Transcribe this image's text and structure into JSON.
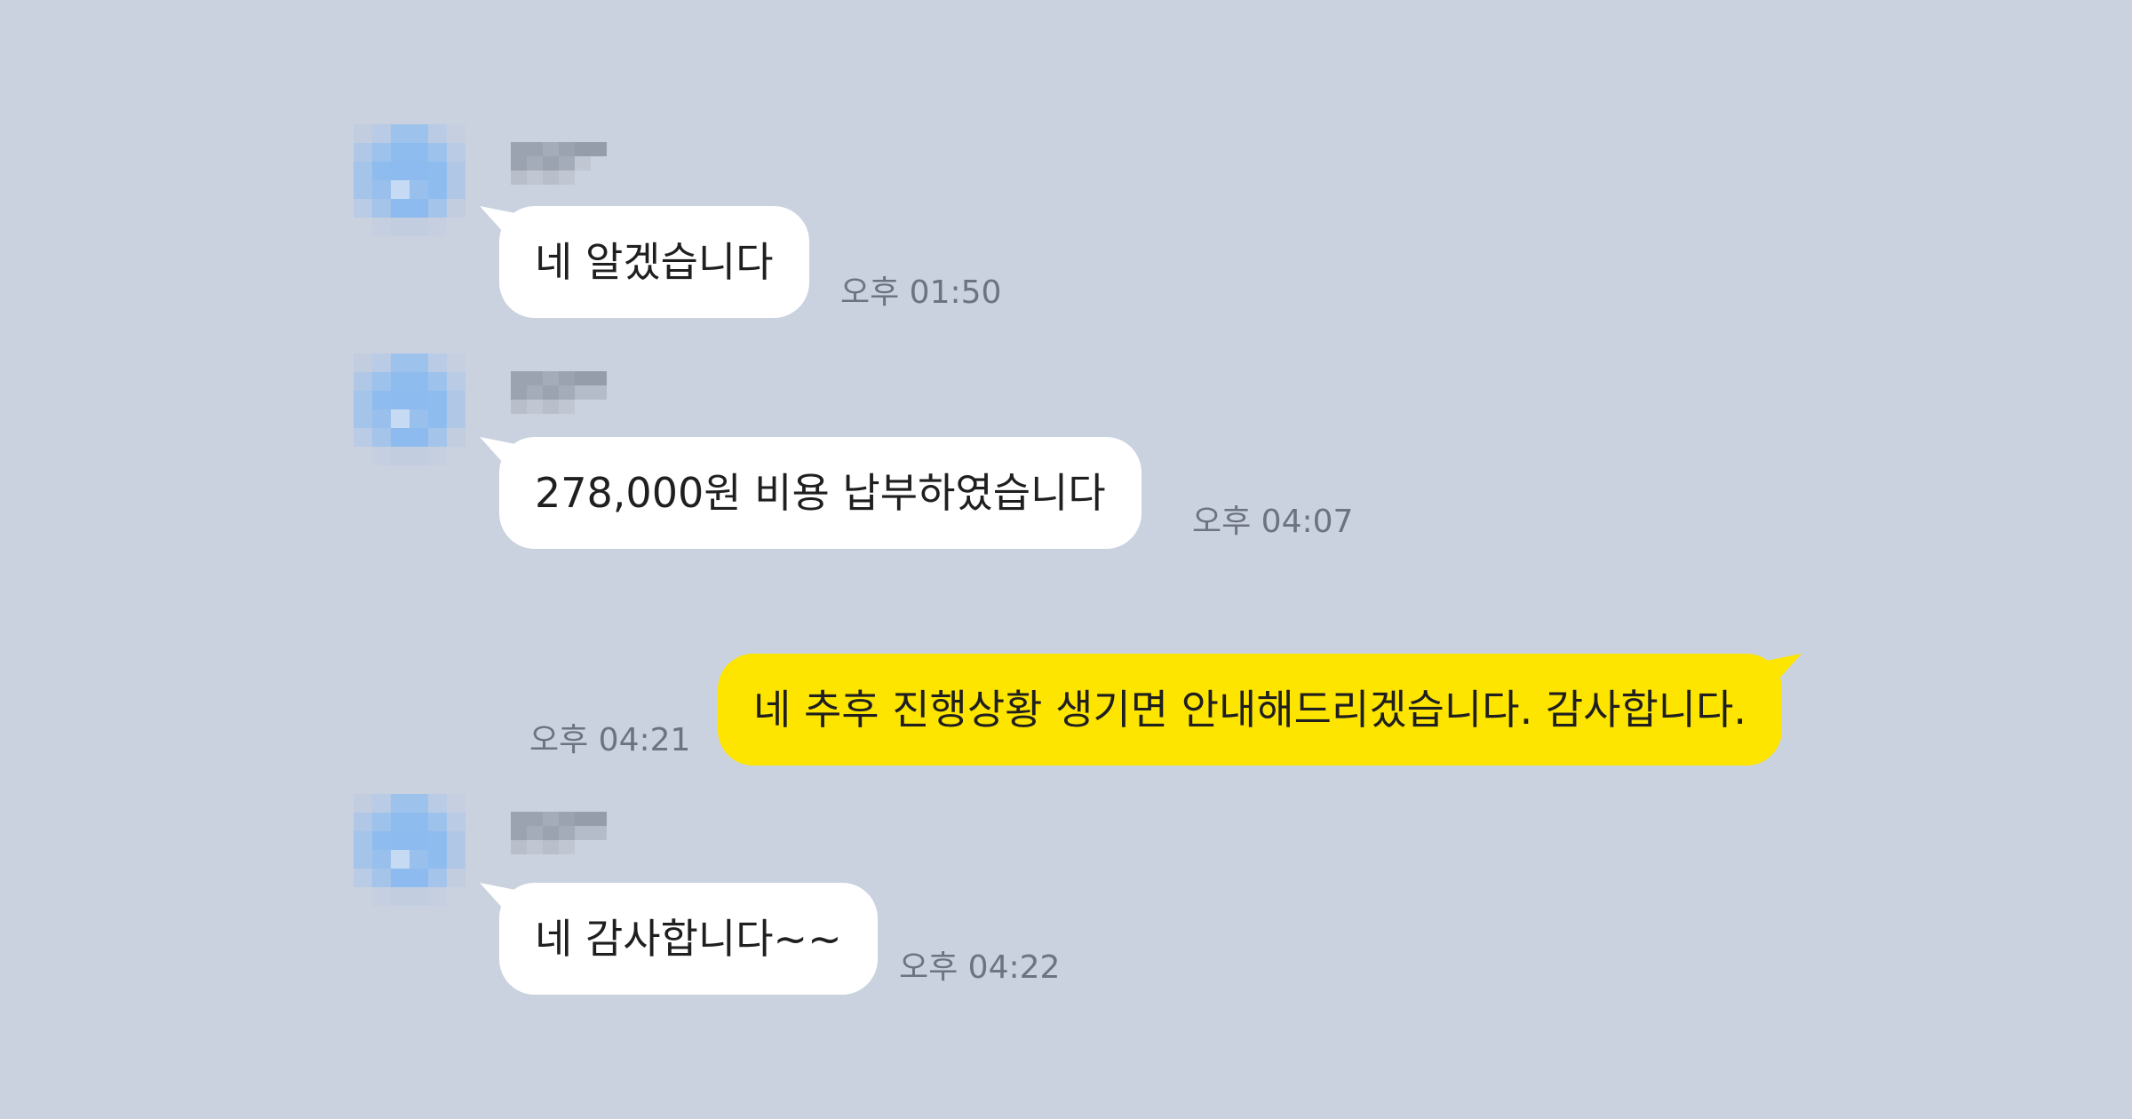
{
  "colors": {
    "background": "#cad2e0",
    "incoming_bubble": "#ffffff",
    "outgoing_bubble": "#fee500",
    "timestamp_text": "#6d7380"
  },
  "messages": [
    {
      "direction": "incoming",
      "text": "네 알겠습니다",
      "time": "오후 01:50"
    },
    {
      "direction": "incoming",
      "text": "278,000원 비용 납부하였습니다",
      "time": "오후 04:07"
    },
    {
      "direction": "outgoing",
      "text": "네 추후 진행상황 생기면 안내해드리겠습니다. 감사합니다.",
      "time": "오후 04:21"
    },
    {
      "direction": "incoming",
      "text": "네 감사합니다~~",
      "time": "오후 04:22"
    }
  ]
}
